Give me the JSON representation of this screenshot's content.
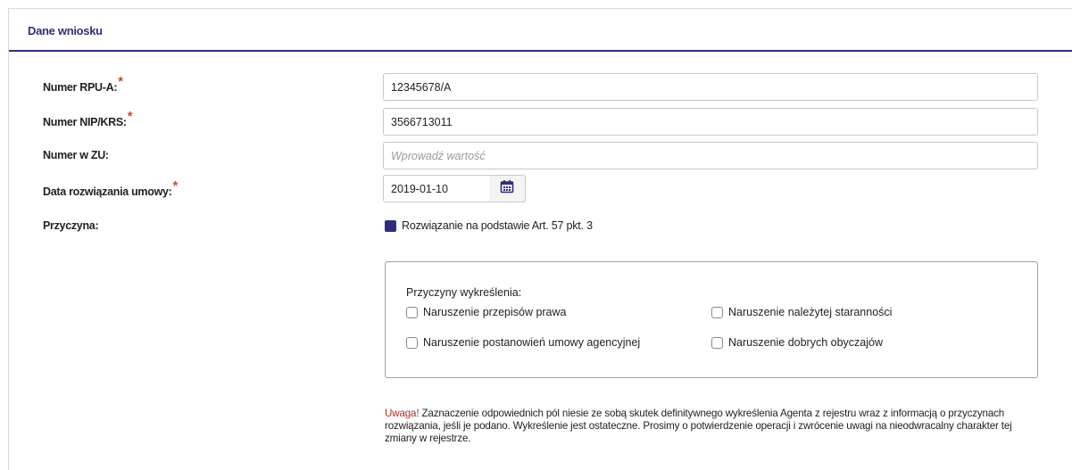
{
  "panel": {
    "title": "Dane wniosku"
  },
  "fields": {
    "rpu": {
      "label": "Numer RPU-A:",
      "required_mark": "*",
      "value": "12345678/A"
    },
    "nip": {
      "label": "Numer NIP/KRS:",
      "required_mark": "*",
      "value": "3566713011"
    },
    "zu": {
      "label": "Numer w ZU:",
      "value": "",
      "placeholder": "Wprowadź wartość"
    },
    "date": {
      "label": "Data rozwiązania umowy:",
      "required_mark": "*",
      "value": "2019-01-10"
    },
    "reason": {
      "label": "Przyczyna:",
      "option": "Rozwiązanie na podstawie Art. 57 pkt. 3",
      "checked": true
    }
  },
  "deletion_reasons": {
    "title": "Przyczyny wykreślenia:",
    "options": [
      {
        "label": "Naruszenie przepisów prawa",
        "checked": false
      },
      {
        "label": "Naruszenie należytej staranności",
        "checked": false
      },
      {
        "label": "Naruszenie postanowień umowy agencyjnej",
        "checked": false
      },
      {
        "label": "Naruszenie dobrych obyczajów",
        "checked": false
      }
    ]
  },
  "warning": {
    "prefix": "Uwaga!",
    "text": " Zaznaczenie odpowiednich pól niesie ze sobą skutek definitywnego wykreślenia Agenta z rejestru wraz z informacją o przyczynach rozwiązania, jeśli je podano. Wykreślenie jest ostateczne. Prosimy o potwierdzenie operacji i zwrócenie uwagi na nieodwracalny charakter tej zmiany w rejestrze."
  },
  "colors": {
    "accent": "#2e2f7c",
    "required": "#c0502c",
    "warning": "#a8322d"
  },
  "icons": {
    "date_picker": "calendar-icon"
  }
}
